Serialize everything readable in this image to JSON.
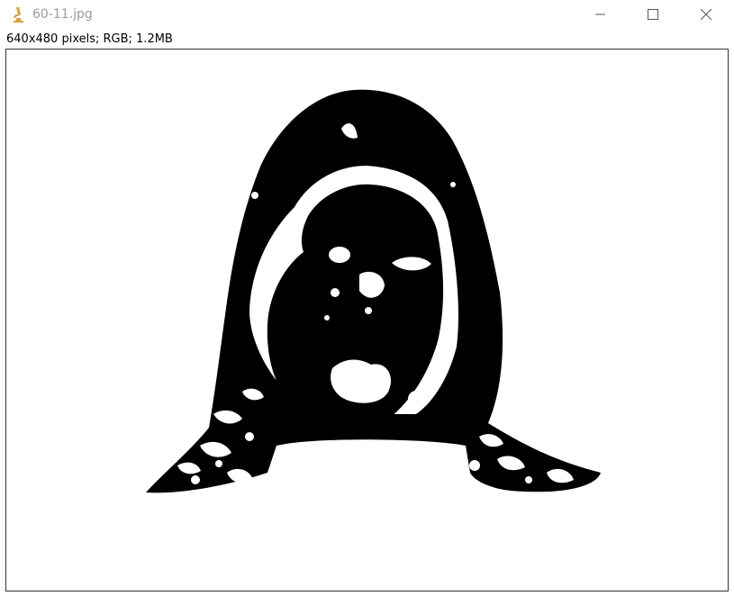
{
  "window": {
    "title": "60-11.jpg",
    "app_icon": "microscope-icon",
    "controls": {
      "minimize_icon": "minimize-icon",
      "maximize_icon": "maximize-icon",
      "close_icon": "close-icon"
    }
  },
  "image_info": {
    "text": "640x480 pixels; RGB; 1.2MB"
  },
  "image": {
    "description_icon": "thresholded-face-image",
    "foreground_color": "#000000",
    "background_color": "#ffffff"
  },
  "colors": {
    "title_text": "#9a9a9a",
    "icon_accent": "#d8a23a"
  }
}
